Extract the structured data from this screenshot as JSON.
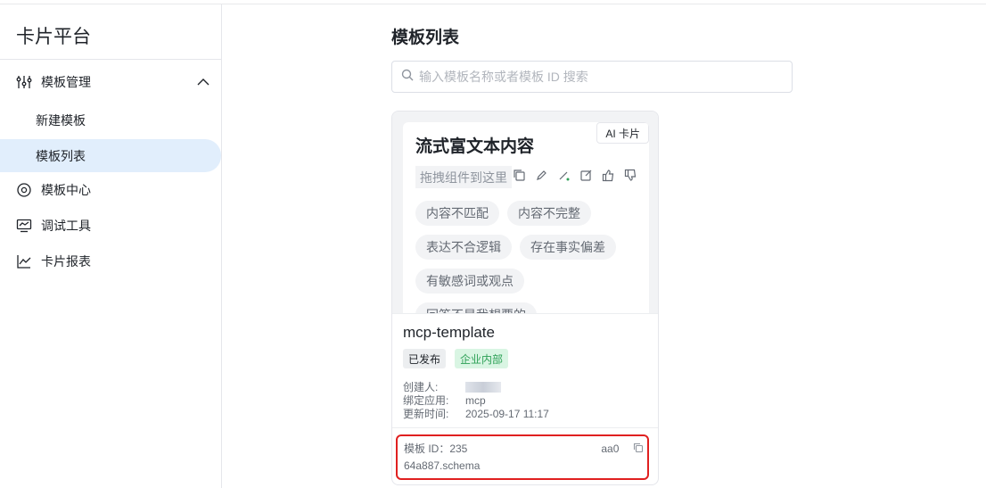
{
  "app": {
    "title": "卡片平台"
  },
  "sidebar": {
    "group": {
      "label": "模板管理",
      "icon": "sliders-icon",
      "expanded": true
    },
    "sub_items": [
      {
        "label": "新建模板",
        "active": false
      },
      {
        "label": "模板列表",
        "active": true
      }
    ],
    "items": [
      {
        "label": "模板中心",
        "icon": "template-center-icon"
      },
      {
        "label": "调试工具",
        "icon": "monitor-icon"
      },
      {
        "label": "卡片报表",
        "icon": "chart-line-icon"
      }
    ]
  },
  "main": {
    "title": "模板列表",
    "search": {
      "placeholder": "输入模板名称或者模板 ID 搜索",
      "value": ""
    }
  },
  "card": {
    "preview": {
      "title": "流式富文本内容",
      "badge": "AI 卡片",
      "drag_hint": "拖拽组件到这里",
      "chips": [
        "内容不匹配",
        "内容不完整",
        "表达不合逻辑",
        "存在事实偏差",
        "有敏感词或观点",
        "回答不是我想要的"
      ]
    },
    "name": "mcp-template",
    "tags": {
      "status": "已发布",
      "scope": "企业内部"
    },
    "meta": {
      "creator_label": "创建人:",
      "app_label": "绑定应用:",
      "app_value": "mcp",
      "updated_label": "更新时间:",
      "updated_value": "2025-09-17 11:17"
    },
    "template_id": {
      "label": "模板 ID：235",
      "tail1": "aa0",
      "line2": "64a887.schema"
    }
  },
  "colors": {
    "accent_active_bg": "#e1eefc",
    "highlight_border": "#e02020",
    "enterprise_tag": "#2ea157"
  }
}
